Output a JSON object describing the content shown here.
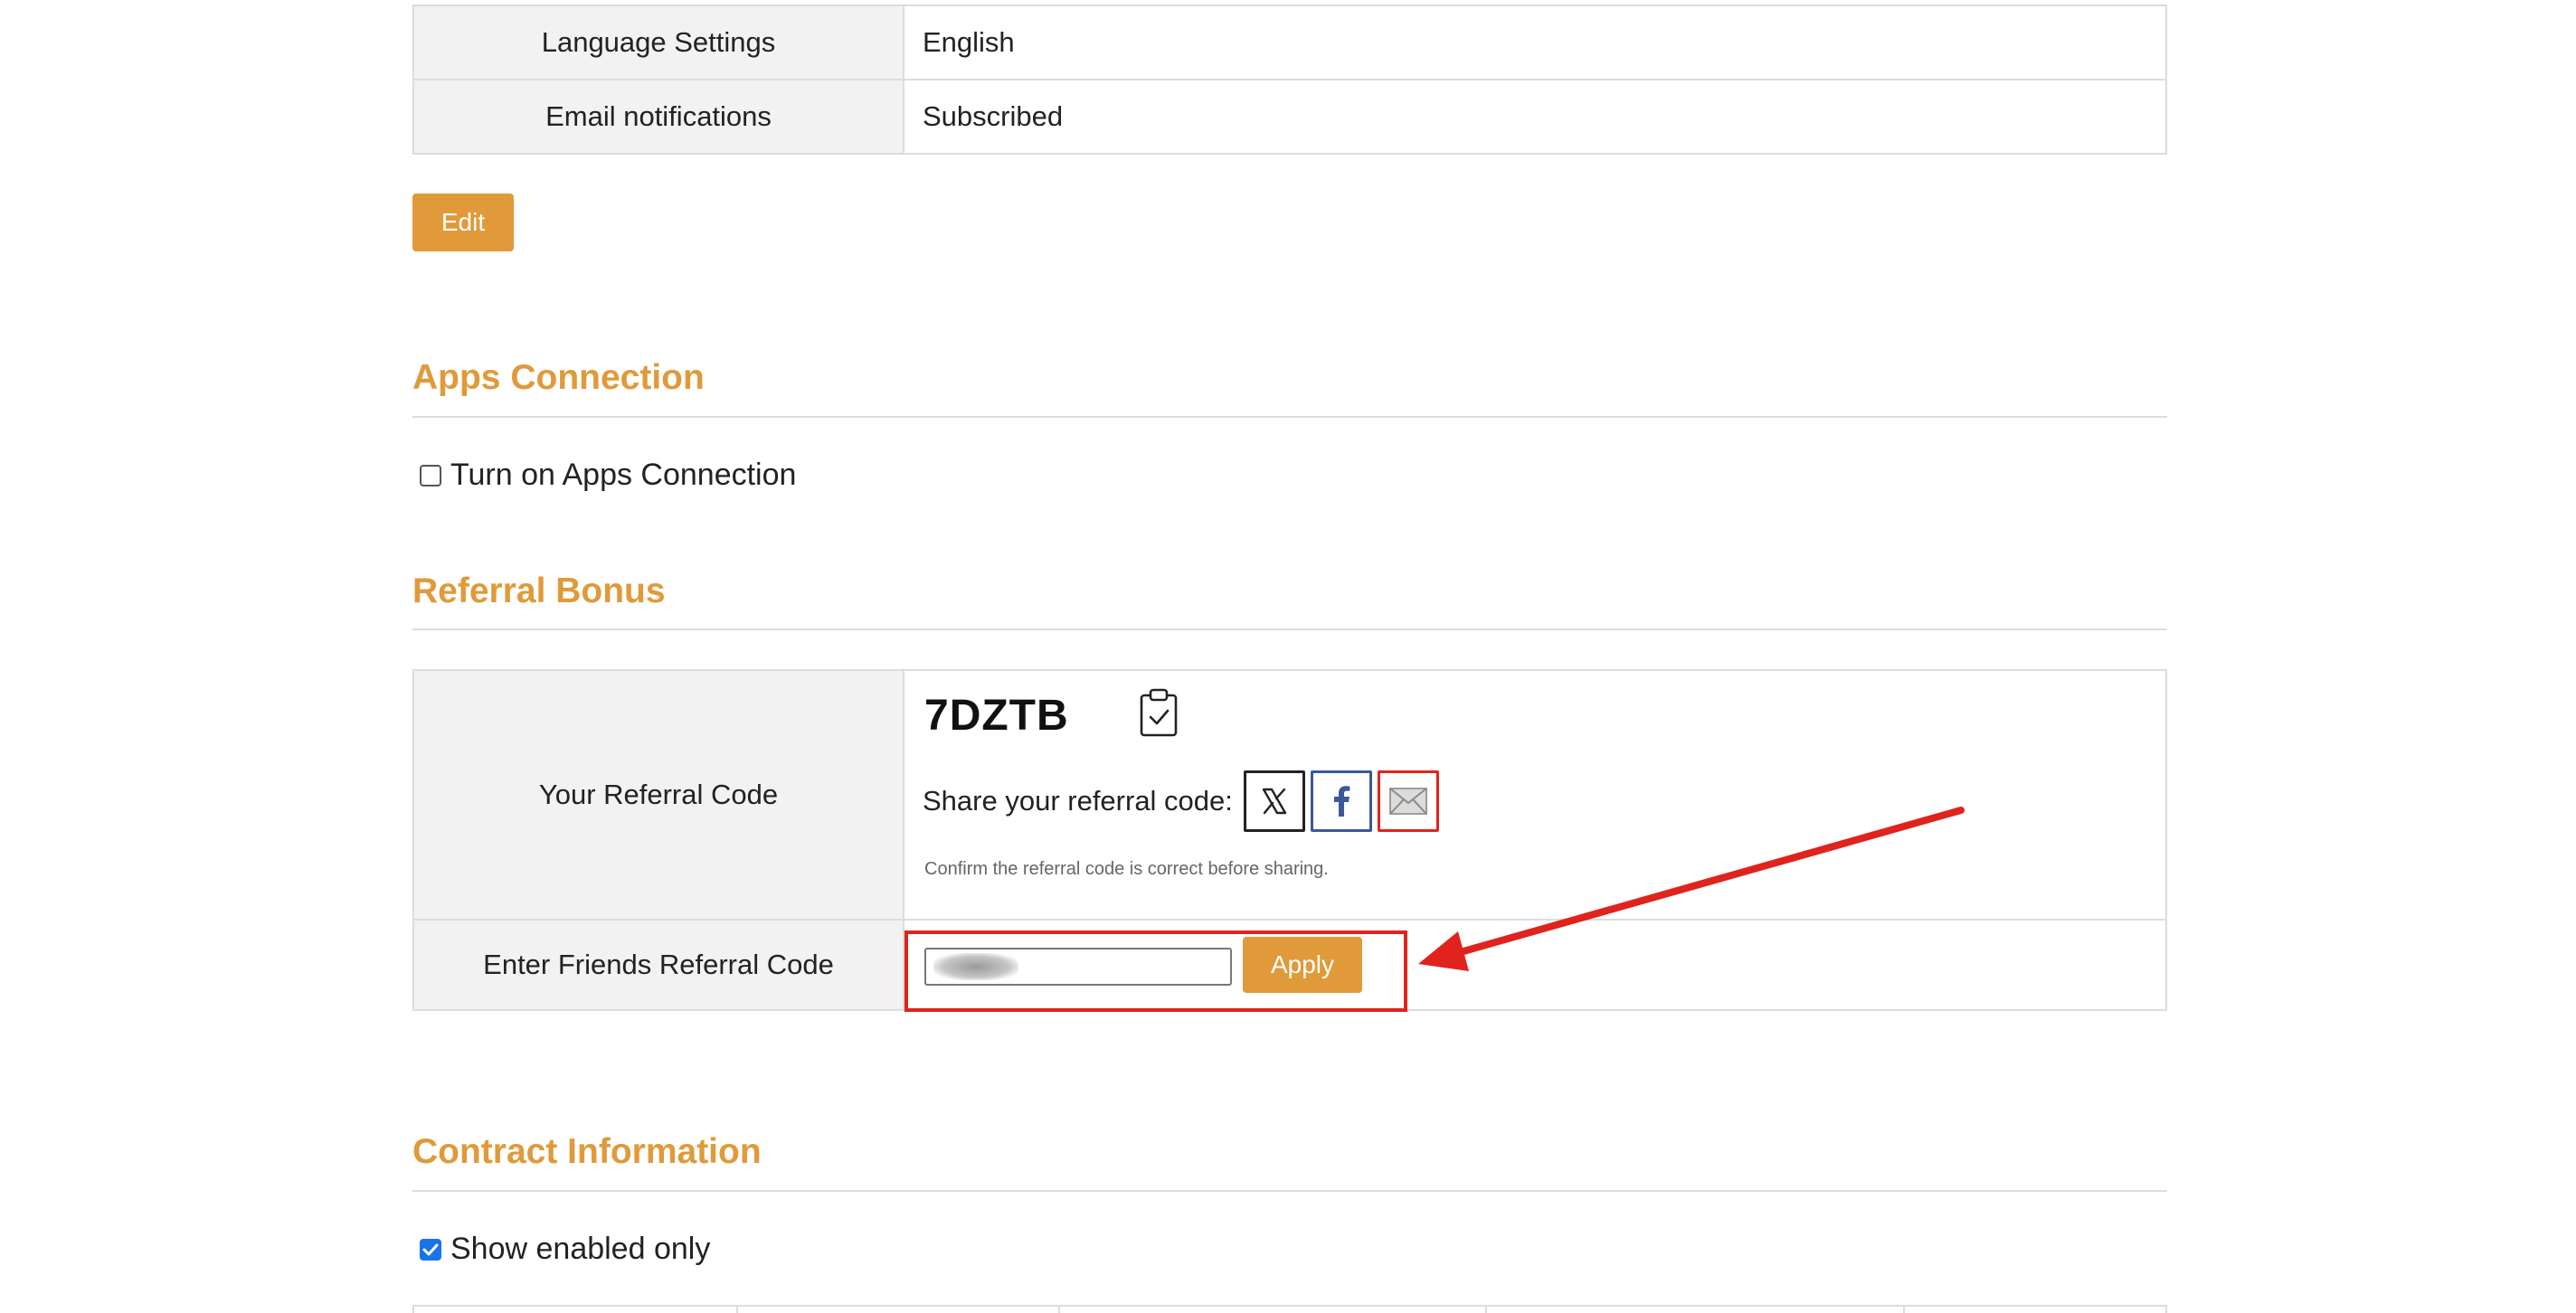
{
  "settings": {
    "rows": [
      {
        "label": "Language Settings",
        "value": "English"
      },
      {
        "label": "Email notifications",
        "value": "Subscribed"
      }
    ],
    "edit_label": "Edit"
  },
  "apps": {
    "title": "Apps Connection",
    "checkbox_label": "Turn on Apps Connection",
    "checked": false
  },
  "referral": {
    "title": "Referral Bonus",
    "your_code_label": "Your Referral Code",
    "code": "7DZTB",
    "share_label": "Share your referral code:",
    "share_buttons": [
      {
        "name": "x-share-button",
        "icon": "x-logo-icon"
      },
      {
        "name": "facebook-share-button",
        "icon": "facebook-logo-icon"
      },
      {
        "name": "email-share-button",
        "icon": "envelope-icon"
      }
    ],
    "note": "Confirm the referral code is correct before sharing.",
    "enter_label": "Enter Friends Referral Code",
    "input_value": "",
    "apply_label": "Apply"
  },
  "contract": {
    "title": "Contract Information",
    "checkbox_label": "Show enabled only",
    "checked": true
  },
  "colors": {
    "accent": "#e09a3a",
    "annotation": "#e0231c",
    "checkbox": "#1a73e8"
  }
}
